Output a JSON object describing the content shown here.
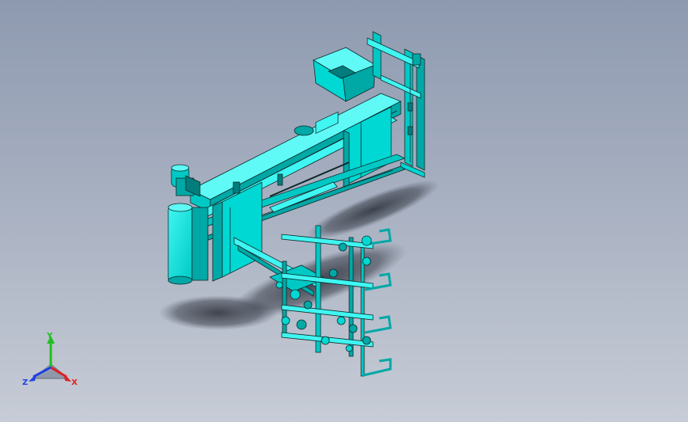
{
  "viewport": {
    "model_colors": {
      "body": "#00e5e0",
      "body_dark": "#00a8a6",
      "body_shade": "#007d7c",
      "edge": "#0f2b2b",
      "shadow": "#3a3f4a"
    }
  },
  "triad": {
    "x_label": "X",
    "y_label": "Y",
    "z_label": "Z",
    "x_color": "#e02020",
    "y_color": "#1fc01f",
    "z_color": "#2040e0"
  }
}
